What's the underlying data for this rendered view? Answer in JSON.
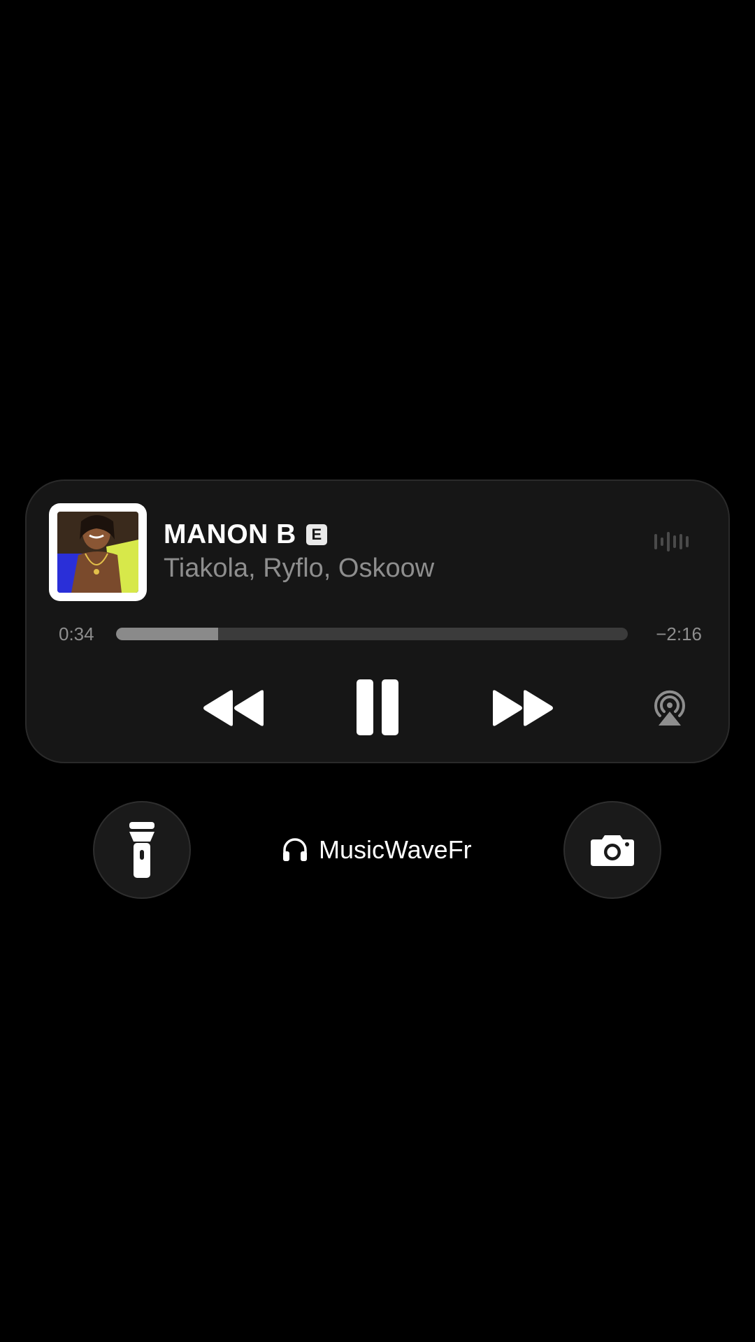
{
  "player": {
    "track_title": "MANON B",
    "explicit_badge": "E",
    "artists": "Tiakola, Ryflo, Oskoow",
    "time_elapsed": "0:34",
    "time_remaining": "−2:16",
    "progress_fraction": 0.2,
    "icons": {
      "album_art": "album-cover-art",
      "waveform": "audio-waveform-icon",
      "rewind": "rewind-icon",
      "pause": "pause-icon",
      "forward": "fast-forward-icon",
      "airplay": "airplay-icon"
    }
  },
  "footer": {
    "device_name": "MusicWaveFr",
    "icons": {
      "flashlight": "flashlight-icon",
      "headphones": "headphones-icon",
      "camera": "camera-icon"
    }
  },
  "colors": {
    "background": "#000000",
    "card": "#161616",
    "primary_text": "#ffffff",
    "secondary_text": "#8e8e8e",
    "progress_fill": "#8a8a8a",
    "progress_track": "#3b3b3b"
  }
}
